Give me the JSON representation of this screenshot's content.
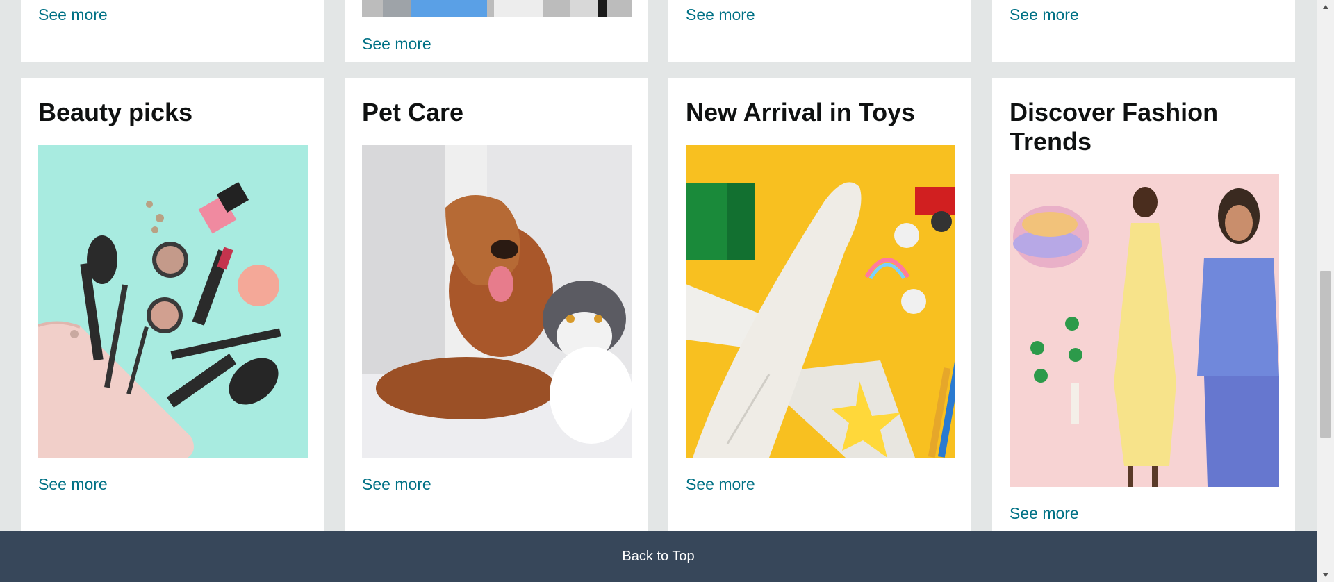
{
  "top_row": [
    {
      "see_more": "See more"
    },
    {
      "see_more": "See more"
    },
    {
      "see_more": "See more"
    },
    {
      "see_more": "See more"
    }
  ],
  "cards": [
    {
      "title": "Beauty picks",
      "image": "makeup-flatlay-image",
      "see_more": "See more"
    },
    {
      "title": "Pet Care",
      "image": "dog-and-cat-image",
      "see_more": "See more"
    },
    {
      "title": "New Arrival in Toys",
      "image": "toy-airplane-image",
      "see_more": "See more"
    },
    {
      "title": "Discover Fashion Trends",
      "image": "fashion-models-image",
      "see_more": "See more"
    }
  ],
  "footer": {
    "back_to_top": "Back to Top"
  },
  "colors": {
    "link": "#007185",
    "footer_bg": "#37475a",
    "page_bg": "#e3e6e6"
  }
}
